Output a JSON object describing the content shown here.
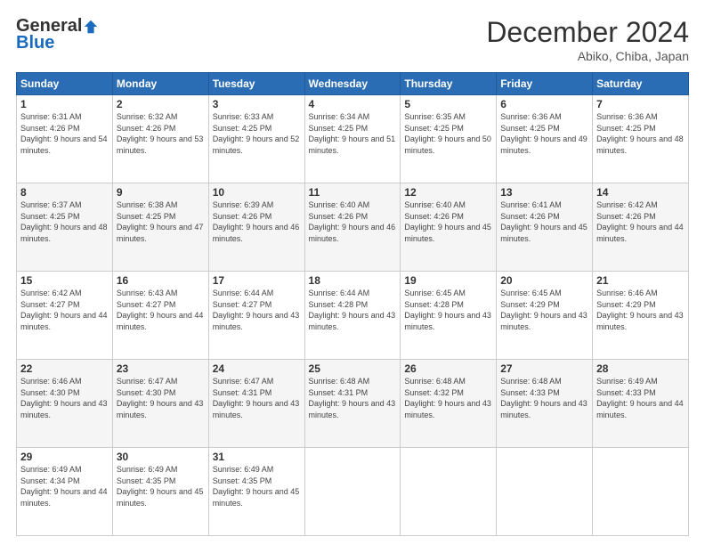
{
  "logo": {
    "general": "General",
    "blue": "Blue"
  },
  "header": {
    "month": "December 2024",
    "location": "Abiko, Chiba, Japan"
  },
  "weekdays": [
    "Sunday",
    "Monday",
    "Tuesday",
    "Wednesday",
    "Thursday",
    "Friday",
    "Saturday"
  ],
  "weeks": [
    [
      {
        "day": "1",
        "sunrise": "6:31 AM",
        "sunset": "4:26 PM",
        "daylight": "9 hours and 54 minutes."
      },
      {
        "day": "2",
        "sunrise": "6:32 AM",
        "sunset": "4:26 PM",
        "daylight": "9 hours and 53 minutes."
      },
      {
        "day": "3",
        "sunrise": "6:33 AM",
        "sunset": "4:25 PM",
        "daylight": "9 hours and 52 minutes."
      },
      {
        "day": "4",
        "sunrise": "6:34 AM",
        "sunset": "4:25 PM",
        "daylight": "9 hours and 51 minutes."
      },
      {
        "day": "5",
        "sunrise": "6:35 AM",
        "sunset": "4:25 PM",
        "daylight": "9 hours and 50 minutes."
      },
      {
        "day": "6",
        "sunrise": "6:36 AM",
        "sunset": "4:25 PM",
        "daylight": "9 hours and 49 minutes."
      },
      {
        "day": "7",
        "sunrise": "6:36 AM",
        "sunset": "4:25 PM",
        "daylight": "9 hours and 48 minutes."
      }
    ],
    [
      {
        "day": "8",
        "sunrise": "6:37 AM",
        "sunset": "4:25 PM",
        "daylight": "9 hours and 48 minutes."
      },
      {
        "day": "9",
        "sunrise": "6:38 AM",
        "sunset": "4:25 PM",
        "daylight": "9 hours and 47 minutes."
      },
      {
        "day": "10",
        "sunrise": "6:39 AM",
        "sunset": "4:26 PM",
        "daylight": "9 hours and 46 minutes."
      },
      {
        "day": "11",
        "sunrise": "6:40 AM",
        "sunset": "4:26 PM",
        "daylight": "9 hours and 46 minutes."
      },
      {
        "day": "12",
        "sunrise": "6:40 AM",
        "sunset": "4:26 PM",
        "daylight": "9 hours and 45 minutes."
      },
      {
        "day": "13",
        "sunrise": "6:41 AM",
        "sunset": "4:26 PM",
        "daylight": "9 hours and 45 minutes."
      },
      {
        "day": "14",
        "sunrise": "6:42 AM",
        "sunset": "4:26 PM",
        "daylight": "9 hours and 44 minutes."
      }
    ],
    [
      {
        "day": "15",
        "sunrise": "6:42 AM",
        "sunset": "4:27 PM",
        "daylight": "9 hours and 44 minutes."
      },
      {
        "day": "16",
        "sunrise": "6:43 AM",
        "sunset": "4:27 PM",
        "daylight": "9 hours and 44 minutes."
      },
      {
        "day": "17",
        "sunrise": "6:44 AM",
        "sunset": "4:27 PM",
        "daylight": "9 hours and 43 minutes."
      },
      {
        "day": "18",
        "sunrise": "6:44 AM",
        "sunset": "4:28 PM",
        "daylight": "9 hours and 43 minutes."
      },
      {
        "day": "19",
        "sunrise": "6:45 AM",
        "sunset": "4:28 PM",
        "daylight": "9 hours and 43 minutes."
      },
      {
        "day": "20",
        "sunrise": "6:45 AM",
        "sunset": "4:29 PM",
        "daylight": "9 hours and 43 minutes."
      },
      {
        "day": "21",
        "sunrise": "6:46 AM",
        "sunset": "4:29 PM",
        "daylight": "9 hours and 43 minutes."
      }
    ],
    [
      {
        "day": "22",
        "sunrise": "6:46 AM",
        "sunset": "4:30 PM",
        "daylight": "9 hours and 43 minutes."
      },
      {
        "day": "23",
        "sunrise": "6:47 AM",
        "sunset": "4:30 PM",
        "daylight": "9 hours and 43 minutes."
      },
      {
        "day": "24",
        "sunrise": "6:47 AM",
        "sunset": "4:31 PM",
        "daylight": "9 hours and 43 minutes."
      },
      {
        "day": "25",
        "sunrise": "6:48 AM",
        "sunset": "4:31 PM",
        "daylight": "9 hours and 43 minutes."
      },
      {
        "day": "26",
        "sunrise": "6:48 AM",
        "sunset": "4:32 PM",
        "daylight": "9 hours and 43 minutes."
      },
      {
        "day": "27",
        "sunrise": "6:48 AM",
        "sunset": "4:33 PM",
        "daylight": "9 hours and 43 minutes."
      },
      {
        "day": "28",
        "sunrise": "6:49 AM",
        "sunset": "4:33 PM",
        "daylight": "9 hours and 44 minutes."
      }
    ],
    [
      {
        "day": "29",
        "sunrise": "6:49 AM",
        "sunset": "4:34 PM",
        "daylight": "9 hours and 44 minutes."
      },
      {
        "day": "30",
        "sunrise": "6:49 AM",
        "sunset": "4:35 PM",
        "daylight": "9 hours and 45 minutes."
      },
      {
        "day": "31",
        "sunrise": "6:49 AM",
        "sunset": "4:35 PM",
        "daylight": "9 hours and 45 minutes."
      },
      null,
      null,
      null,
      null
    ]
  ]
}
